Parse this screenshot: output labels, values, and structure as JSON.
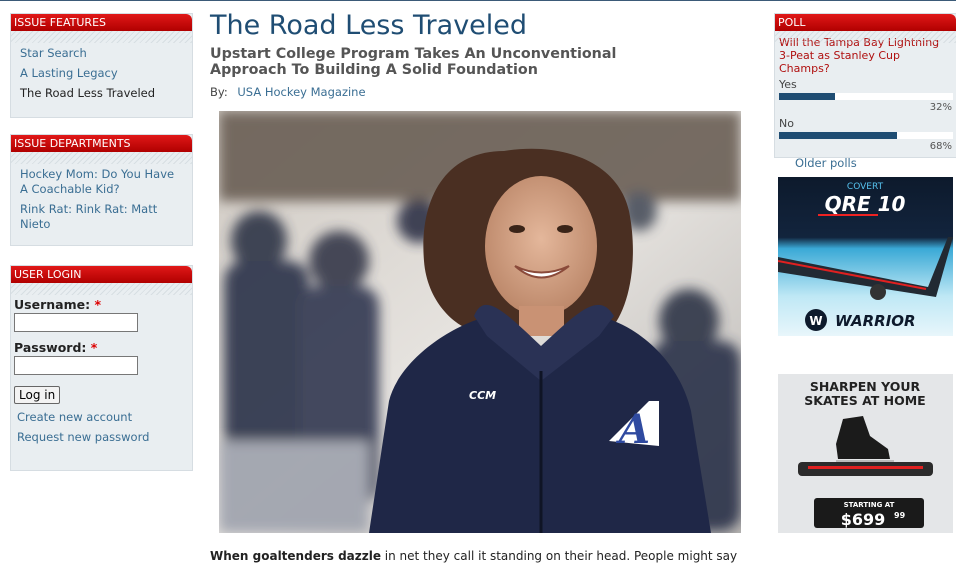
{
  "sidebar": {
    "features": {
      "title": "ISSUE FEATURES",
      "items": [
        "Star Search",
        "A Lasting Legacy",
        "The Road Less Traveled"
      ]
    },
    "departments": {
      "title": "ISSUE DEPARTMENTS",
      "items": [
        "Hockey Mom: Do You Have A Coachable Kid?",
        "Rink Rat: Rink Rat: Matt Nieto"
      ]
    },
    "login": {
      "title": "USER LOGIN",
      "username_label": "Username:",
      "password_label": "Password:",
      "required_mark": "*",
      "login_button": "Log in",
      "create_account": "Create new account",
      "request_password": "Request new password"
    }
  },
  "article": {
    "title": "The Road Less Traveled",
    "subtitle": "Upstart College Program Takes An Unconventional Approach To Building A Solid Foundation",
    "by_label": "By:",
    "author": "USA Hockey Magazine",
    "intro_bold": "When goaltenders dazzle",
    "intro_rest": " in net they call it standing on their head. People might say"
  },
  "poll": {
    "title": "POLL",
    "question": "Will the Tampa Bay Lightning 3-Peat as Stanley Cup Champs?",
    "options": [
      {
        "label": "Yes",
        "percent": 32,
        "percent_text": "32%"
      },
      {
        "label": "No",
        "percent": 68,
        "percent_text": "68%"
      }
    ],
    "older_link": "Older polls"
  },
  "ads": {
    "covert": {
      "brand_top": "COVERT",
      "model": "QRE 10",
      "brand": "WARRIOR"
    },
    "skates": {
      "headline": "SHARPEN YOUR SKATES AT HOME",
      "starting_at": "STARTING AT",
      "price": "$699",
      "cents": "99"
    }
  },
  "colors": {
    "accent_red": "#c80000",
    "link_blue": "#3a6e93",
    "title_blue": "#1f4d73",
    "block_bg": "#e9eef1"
  }
}
